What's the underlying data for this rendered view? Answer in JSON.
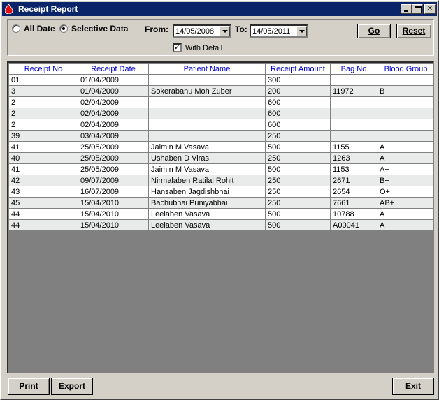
{
  "window": {
    "title": "Receipt Report"
  },
  "filters": {
    "all_date_label": "All Date",
    "selective_data_label": "Selective Data",
    "selected": "selective",
    "from_label": "From:",
    "from_value": "14/05/2008",
    "to_label": "To:",
    "to_value": "14/05/2011",
    "with_detail_label": "With Detail",
    "with_detail_checked": true,
    "go_label": "Go",
    "reset_label": "Reset"
  },
  "grid": {
    "columns": [
      "Receipt No",
      "Receipt Date",
      "Patient Name",
      "Receipt Amount",
      "Bag No",
      "Blood Group"
    ],
    "rows": [
      [
        "01",
        "01/04/2009",
        "",
        "300",
        "",
        ""
      ],
      [
        "3",
        "01/04/2009",
        "Sokerabanu Moh Zuber",
        "200",
        "11972",
        "B+"
      ],
      [
        "2",
        "02/04/2009",
        "",
        "600",
        "",
        ""
      ],
      [
        "2",
        "02/04/2009",
        "",
        "600",
        "",
        ""
      ],
      [
        "2",
        "02/04/2009",
        "",
        "600",
        "",
        ""
      ],
      [
        "39",
        "03/04/2009",
        "",
        "250",
        "",
        ""
      ],
      [
        "41",
        "25/05/2009",
        "Jaimin M Vasava",
        "500",
        "1155",
        "A+"
      ],
      [
        "40",
        "25/05/2009",
        "Ushaben D Viras",
        "250",
        "1263",
        "A+"
      ],
      [
        "41",
        "25/05/2009",
        "Jaimin M Vasava",
        "500",
        "1153",
        "A+"
      ],
      [
        "42",
        "09/07/2009",
        "Nirmalaben Ratilal Rohit",
        "250",
        "2671",
        "B+"
      ],
      [
        "43",
        "16/07/2009",
        "Hansaben Jagdishbhai",
        "250",
        "2654",
        "O+"
      ],
      [
        "45",
        "15/04/2010",
        "Bachubhai Puniyabhai",
        "250",
        "7661",
        "AB+"
      ],
      [
        "44",
        "15/04/2010",
        "Leelaben Vasava",
        "500",
        "10788",
        "A+"
      ],
      [
        "44",
        "15/04/2010",
        "Leelaben Vasava",
        "500",
        "A00041",
        "A+"
      ]
    ]
  },
  "footer": {
    "print_label": "Print",
    "export_label": "Export",
    "exit_label": "Exit"
  },
  "colors": {
    "title_bar": "#0a246a",
    "header_text": "#0000cc",
    "grid_bg": "#808080",
    "row_alt": "#e9ebeb"
  }
}
